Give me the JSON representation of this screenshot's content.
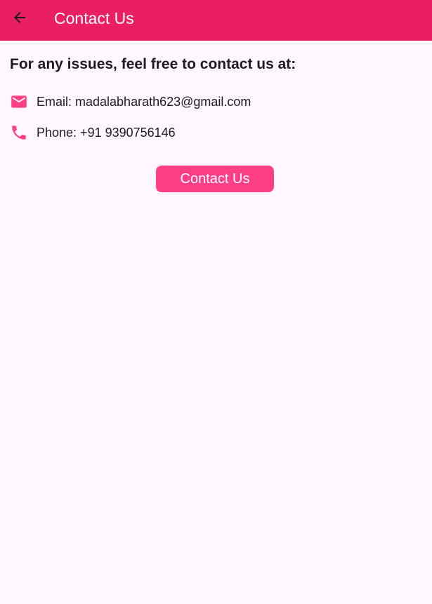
{
  "app_bar": {
    "title": "Contact Us",
    "back_icon": "arrow-back-icon",
    "background_color": "#ea1e63",
    "title_color": "#ffffff"
  },
  "main": {
    "heading": "For any issues, feel free to contact us at:",
    "email": {
      "icon": "email-icon",
      "label": "Email: madalabharath623@gmail.com"
    },
    "phone": {
      "icon": "phone-icon",
      "label": "Phone: +91 9390756146"
    },
    "contact_button": {
      "label": "Contact Us",
      "background_color": "#ff3f85"
    },
    "icon_color": "#ff3f85",
    "background_color": "#fff7fd"
  }
}
